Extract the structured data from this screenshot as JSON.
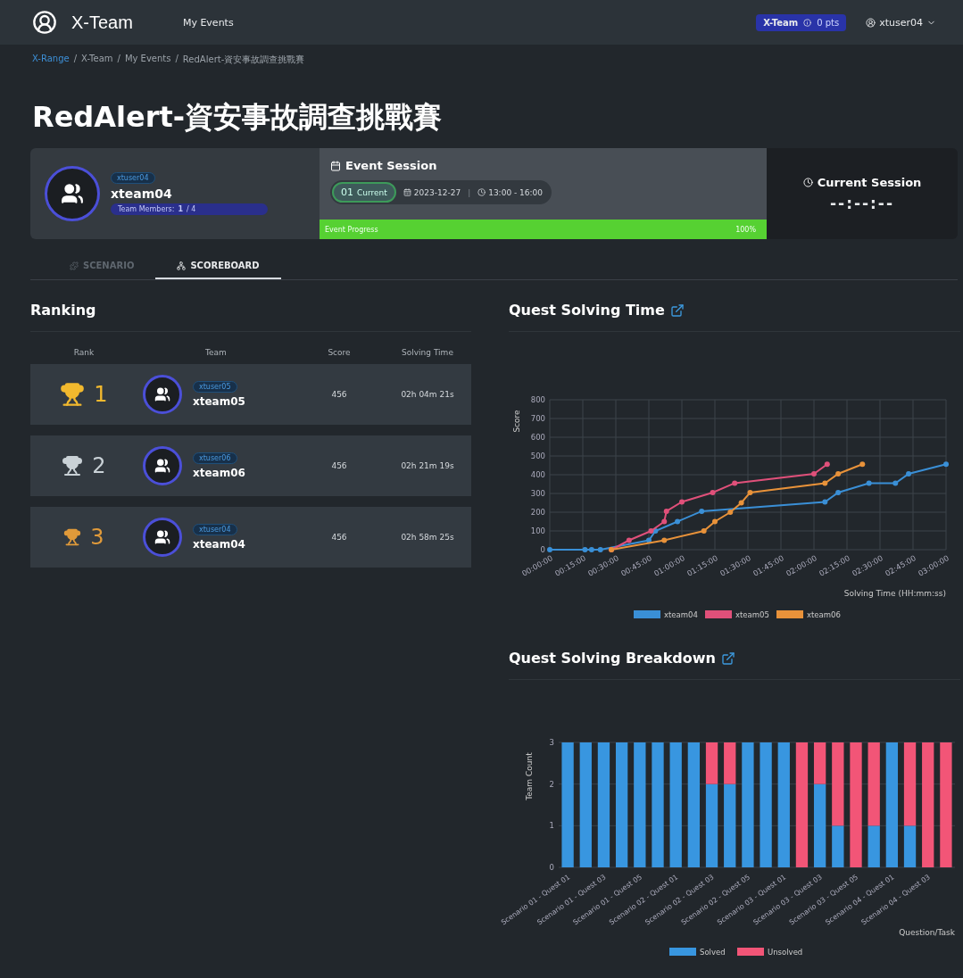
{
  "navbar": {
    "brand": "X-Team",
    "links": [
      {
        "label": "My Events"
      }
    ],
    "team_badge": {
      "team": "X-Team",
      "points": "0 pts"
    },
    "user": "xtuser04"
  },
  "breadcrumb": [
    {
      "label": "X-Range",
      "link": true
    },
    {
      "label": "X-Team",
      "link": false
    },
    {
      "label": "My Events",
      "link": false
    },
    {
      "label": "RedAlert-資安事故調查挑戰賽",
      "link": false
    }
  ],
  "breadcrumb_separator": "/",
  "page_title": "RedAlert-資安事故調查挑戰賽",
  "team_card": {
    "user_tag": "xtuser04",
    "name": "xteam04",
    "members_label": "Team Members:",
    "members_count": "1",
    "members_total": "/ 4"
  },
  "event_session": {
    "title": "Event Session",
    "session_no": "01",
    "session_status": "Current",
    "date": "2023-12-27",
    "separator": "|",
    "time": "13:00 - 16:00",
    "progress_label": "Event Progress",
    "progress_text": "100%",
    "level": 1
  },
  "current_session": {
    "title": "Current Session",
    "value": "--:--:--"
  },
  "tabs": [
    {
      "label": "SCENARIO",
      "selected": false,
      "kind": "puzzle"
    },
    {
      "label": "SCOREBOARD",
      "selected": true,
      "kind": "network"
    }
  ],
  "ranking": {
    "title": "Ranking",
    "columns": [
      "Rank",
      "Team",
      "Score",
      "Solving Time"
    ],
    "rows": [
      {
        "rank": "1",
        "color": "#f2b92e",
        "user_tag": "xtuser05",
        "team": "xteam05",
        "score": "456",
        "time": "02h 04m 21s"
      },
      {
        "rank": "2",
        "color": "#c9d1d6",
        "user_tag": "xtuser06",
        "team": "xteam06",
        "score": "456",
        "time": "02h 21m 19s"
      },
      {
        "rank": "3",
        "color": "#e09a3a",
        "user_tag": "xtuser04",
        "team": "xteam04",
        "score": "456",
        "time": "02h 58m 25s"
      }
    ]
  },
  "time_chart": {
    "title": "Quest Solving Time",
    "chart_data": {
      "type": "line",
      "xlabel": "Solving Time (HH:mm:ss)",
      "ylabel": "Score",
      "legend": true,
      "grid": true,
      "xlim": [
        0,
        180
      ],
      "ylim": [
        0,
        800
      ],
      "yticks": [
        0,
        100,
        200,
        300,
        400,
        500,
        600,
        700,
        800
      ],
      "xticks": [
        {
          "value": 0,
          "label": "00:00:00"
        },
        {
          "value": 15,
          "label": "00:15:00"
        },
        {
          "value": 30,
          "label": "00:30:00"
        },
        {
          "value": 45,
          "label": "00:45:00"
        },
        {
          "value": 60,
          "label": "01:00:00"
        },
        {
          "value": 75,
          "label": "01:15:00"
        },
        {
          "value": 90,
          "label": "01:30:00"
        },
        {
          "value": 105,
          "label": "01:45:00"
        },
        {
          "value": 120,
          "label": "02:00:00"
        },
        {
          "value": 135,
          "label": "02:15:00"
        },
        {
          "value": 150,
          "label": "02:30:00"
        },
        {
          "value": 165,
          "label": "02:45:00"
        },
        {
          "value": 180,
          "label": "03:00:00"
        }
      ],
      "x": [
        0,
        16,
        19,
        23,
        28,
        36,
        45,
        46,
        48,
        52,
        53,
        58,
        60,
        69,
        70,
        74,
        75,
        82,
        84,
        87,
        91,
        120,
        125,
        126,
        131,
        142,
        145,
        157,
        163,
        180
      ],
      "series": [
        {
          "name": "xteam04",
          "color": "#3a8fd6",
          "marker": "circle",
          "values": [
            0,
            0,
            0,
            0,
            null,
            null,
            50,
            null,
            100,
            null,
            null,
            150,
            null,
            205,
            null,
            null,
            null,
            null,
            null,
            null,
            null,
            null,
            255,
            null,
            305,
            null,
            355,
            355,
            405,
            456
          ]
        },
        {
          "name": "xteam05",
          "color": "#e0507a",
          "marker": "circle",
          "values": [
            null,
            null,
            null,
            null,
            0,
            50,
            null,
            100,
            null,
            150,
            205,
            null,
            255,
            null,
            null,
            305,
            null,
            null,
            355,
            null,
            null,
            405,
            null,
            456,
            null,
            null,
            null,
            null,
            null,
            null
          ]
        },
        {
          "name": "xteam06",
          "color": "#e8923a",
          "marker": "circle",
          "values": [
            null,
            null,
            null,
            null,
            0,
            null,
            null,
            null,
            null,
            50,
            null,
            null,
            null,
            null,
            100,
            null,
            150,
            200,
            null,
            250,
            305,
            null,
            355,
            null,
            405,
            456,
            null,
            null,
            null,
            null
          ]
        }
      ]
    }
  },
  "breakdown_chart": {
    "title": "Quest Solving Breakdown",
    "chart_data": {
      "type": "bar",
      "stacked": true,
      "xlabel": "Question/Task",
      "ylabel": "Team Count",
      "legend": true,
      "grid": true,
      "ylim": [
        0,
        3
      ],
      "yticks": [
        0,
        1,
        2,
        3
      ],
      "categories": [
        "Scenario 01 - Quest 01",
        null,
        "Scenario 01 - Quest 03",
        null,
        "Scenario 01 - Quest 05",
        null,
        "Scenario 02 - Quest 01",
        null,
        "Scenario 02 - Quest 03",
        null,
        "Scenario 02 - Quest 05",
        null,
        "Scenario 03 - Quest 01",
        null,
        "Scenario 03 - Quest 03",
        null,
        "Scenario 03 - Quest 05",
        null,
        "Scenario 04 - Quest 01",
        null,
        "Scenario 04 - Quest 03",
        null
      ],
      "series": [
        {
          "name": "Solved",
          "color": "#3896e0",
          "values": [
            3,
            3,
            3,
            3,
            3,
            3,
            3,
            3,
            2,
            2,
            3,
            3,
            3,
            0,
            2,
            1,
            0,
            1,
            3,
            1,
            0,
            0
          ]
        },
        {
          "name": "Unsolved",
          "color": "#f25577",
          "values": [
            0,
            0,
            0,
            0,
            0,
            0,
            0,
            0,
            1,
            1,
            0,
            0,
            0,
            3,
            1,
            2,
            3,
            2,
            0,
            2,
            3,
            3
          ]
        }
      ]
    }
  }
}
